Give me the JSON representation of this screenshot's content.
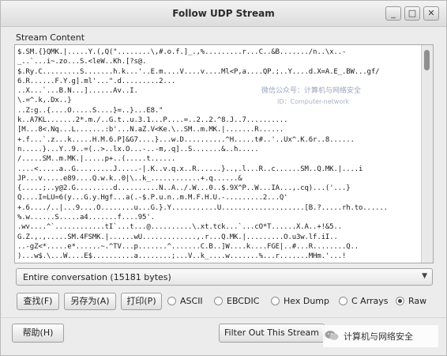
{
  "window": {
    "title": "Follow UDP Stream",
    "buttons": {
      "minimize": "_",
      "maximize": "□",
      "close": "✕"
    }
  },
  "stream": {
    "label": "Stream Content",
    "lines": [
      "$.SM.{}QMK.|.....Y.(,Q(\"........\\,#.o.f.]_.,%.........r...C..&B......./n..\\x..-",
      "_..`...i~.zo...S.<leW..Kh.[?s@.",
      "$.Ry.C.........S.......h.k...'..E.m....V....v....Ml<P,a....QP.;..Y....d.X=A.E_.BW...gf/",
      "6.R......F.Y.g].ml'...\".d.........2...",
      "..X...`...B.N...]......Av..I.",
      "\\.=^.k,.Dx..}",
      "..Z:g..{....O.....S....}=..}...E8.\"",
      "k..A7KL.......2*.m./..G.t..u.3.1...P....=..2..2.^8.J..7..........",
      "[M...8<.Nq...L.......:b'...N.aZ.V<Ke.\\..SM..m.MK.|.......R......",
      "+.f...`.z...k.....H.M.6.P]&G7....}...w.D..........^H.....t#..'..Ux^.K.6r..8......",
      "n.....}...Y..9..=(..>..lx.O...-..-m,.q]..S.......&..h.....",
      "/.....SM..m.MK.|.....p+..(.....t......",
      "....<.....a..G.........J.....-|.K..v.q.x..R......}..,.l...R..c......SM..Q.MK.|....i",
      "JP...v.....e89....Q.w.k..0|\\..k_............+.q......&",
      "{.....;..y@2.G.........d..........N..A../.W...0..$.9X^P..W...IA...,.cq)...('...}",
      "Q....I=LU=6(y...G.y.Hgf...a(.-$.P.u.n..m.M.F.H.U.-.........2...Q'",
      "+.6..../..|...9....O........u...G.}.Y...........U....................[B.?.....rh.to......",
      "%.w......S.....a4.......f....95'.",
      ".wv....^`............tI`...t...@..........\\.xt.tck...`...cO*T......X.A..+!&5..",
      "G.Z.,.,.....SM.4FSMK.|......wU.............,.r...Q.MK.|.........O.u3w.lf.iI..",
      "..-gZ<*.....e*......~.^TV...p.......^.......C.B..]W....k....FGE|..#...R........Q..",
      ")...w$.\\...W....E$..........a........;...V..k_....w.......%...r.......MHm.'...!",
      "V...SM..~.MK.|..........C.................SM...a..MK.|..........r.......Al...........2.."
    ]
  },
  "watermark": {
    "line1": "微信公众号：计算机与网络安全",
    "line2": "ID：Computer-network"
  },
  "conversation_select": {
    "value": "Entire conversation (15181 bytes)"
  },
  "toolbar": {
    "find": "查找(F)",
    "save_as": "另存为(A)",
    "print": "打印(P)"
  },
  "format_options": [
    {
      "label": "ASCII",
      "checked": false
    },
    {
      "label": "EBCDIC",
      "checked": false
    },
    {
      "label": "Hex Dump",
      "checked": false
    },
    {
      "label": "C Arrays",
      "checked": false
    },
    {
      "label": "Raw",
      "checked": true
    }
  ],
  "footer": {
    "help": "帮助(H)",
    "filter_out": "Filter Out This Stream",
    "brand": "计算机与网络安全"
  }
}
